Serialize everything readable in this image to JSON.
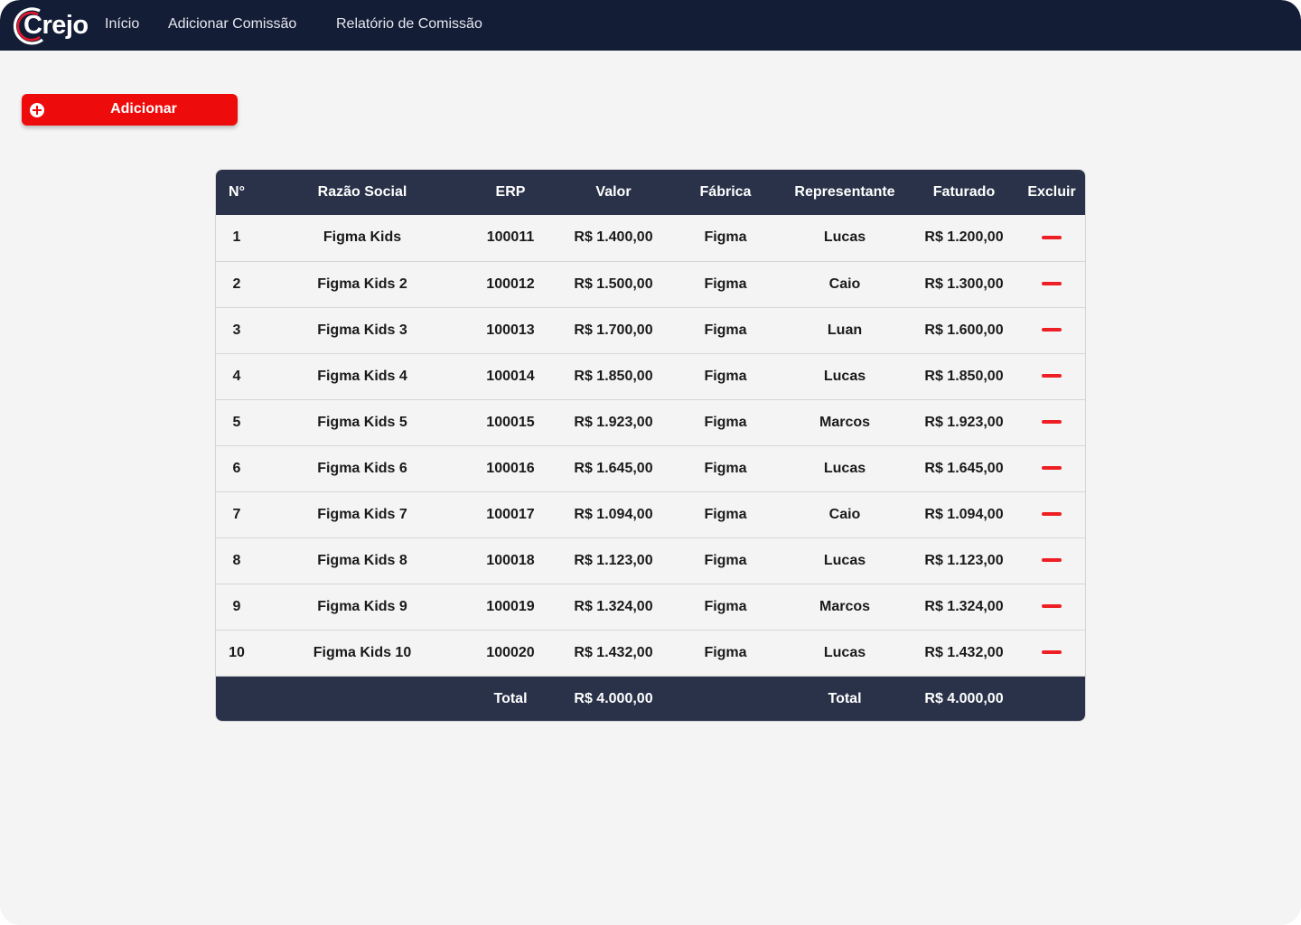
{
  "nav": {
    "brand": "Crejo",
    "items": [
      "Início",
      "Adicionar Comissão",
      "Relatório de Comissão"
    ]
  },
  "actions": {
    "add_label": "Adicionar"
  },
  "colors": {
    "topbar": "#141d36",
    "table_header": "#293249",
    "accent_red": "#ee0b0b",
    "background": "#f4f4f4"
  },
  "table": {
    "headers": [
      "N°",
      "Razão Social",
      "ERP",
      "Valor",
      "Fábrica",
      "Representante",
      "Faturado",
      "Excluir"
    ],
    "rows": [
      [
        "1",
        "Figma Kids",
        "100011",
        "R$ 1.400,00",
        "Figma",
        "Lucas",
        "R$ 1.200,00"
      ],
      [
        "2",
        "Figma Kids 2",
        "100012",
        "R$ 1.500,00",
        "Figma",
        "Caio",
        "R$ 1.300,00"
      ],
      [
        "3",
        "Figma Kids 3",
        "100013",
        "R$ 1.700,00",
        "Figma",
        "Luan",
        "R$ 1.600,00"
      ],
      [
        "4",
        "Figma Kids 4",
        "100014",
        "R$ 1.850,00",
        "Figma",
        "Lucas",
        "R$ 1.850,00"
      ],
      [
        "5",
        "Figma Kids 5",
        "100015",
        "R$ 1.923,00",
        "Figma",
        "Marcos",
        "R$ 1.923,00"
      ],
      [
        "6",
        "Figma Kids 6",
        "100016",
        "R$ 1.645,00",
        "Figma",
        "Lucas",
        "R$ 1.645,00"
      ],
      [
        "7",
        "Figma Kids 7",
        "100017",
        "R$ 1.094,00",
        "Figma",
        "Caio",
        "R$ 1.094,00"
      ],
      [
        "8",
        "Figma Kids 8",
        "100018",
        "R$ 1.123,00",
        "Figma",
        "Lucas",
        "R$ 1.123,00"
      ],
      [
        "9",
        "Figma Kids 9",
        "100019",
        "R$ 1.324,00",
        "Figma",
        "Marcos",
        "R$ 1.324,00"
      ],
      [
        "10",
        "Figma Kids 10",
        "100020",
        "R$ 1.432,00",
        "Figma",
        "Lucas",
        "R$ 1.432,00"
      ]
    ],
    "delete_icon": "minus-icon",
    "footer": {
      "valor_label": "Total",
      "valor_total": "R$ 4.000,00",
      "faturado_label": "Total",
      "faturado_total": "R$ 4.000,00"
    }
  }
}
